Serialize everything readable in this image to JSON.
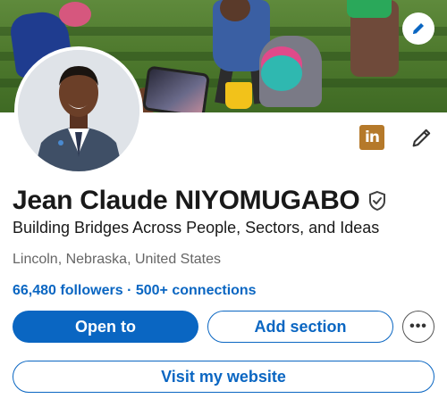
{
  "profile": {
    "name": "Jean Claude NIYOMUGABO",
    "headline": "Building Bridges Across People, Sectors, and Ideas",
    "location": "Lincoln, Nebraska, United States",
    "followers": "66,480 followers",
    "separator": "·",
    "connections": "500+ connections"
  },
  "actions": {
    "open_to": "Open to",
    "add_section": "Add section",
    "more": "•••",
    "visit_website": "Visit my website"
  },
  "icons": {
    "edit_cover": "pencil-icon",
    "linkedin_badge": "linkedin-icon",
    "linkedin_text": "in",
    "edit_profile": "pencil-icon",
    "verified": "shield-check-icon"
  },
  "colors": {
    "accent": "#0a66c2",
    "linkedin_badge": "#b5792a",
    "text_secondary": "#666666"
  }
}
